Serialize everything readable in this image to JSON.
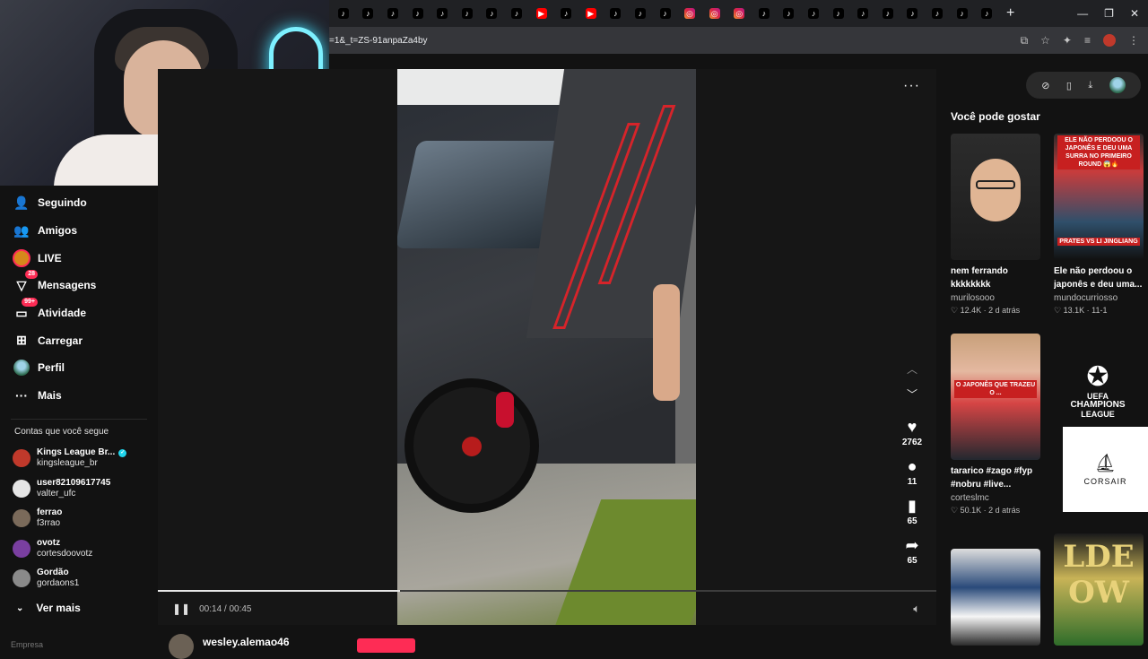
{
  "browser": {
    "tabs": [
      {
        "icon": "tiktok-icon",
        "glyph": "♪"
      },
      {
        "icon": "tiktok-icon",
        "glyph": "♪"
      },
      {
        "icon": "tiktok-icon",
        "glyph": "♪"
      },
      {
        "icon": "tiktok-icon",
        "glyph": "♪"
      },
      {
        "icon": "tiktok-icon",
        "glyph": "♪"
      },
      {
        "icon": "tiktok-icon",
        "glyph": "♪"
      },
      {
        "icon": "tiktok-icon",
        "glyph": "♪"
      },
      {
        "icon": "tiktok-icon",
        "glyph": "♪"
      },
      {
        "icon": "youtube-icon",
        "glyph": "▶"
      },
      {
        "icon": "tiktok-icon",
        "glyph": "♪"
      },
      {
        "icon": "youtube-icon",
        "glyph": "▶"
      },
      {
        "icon": "tiktok-icon",
        "glyph": "♪"
      },
      {
        "icon": "tiktok-icon",
        "glyph": "♪"
      },
      {
        "icon": "tiktok-icon",
        "glyph": "♪"
      },
      {
        "icon": "instagram-icon",
        "glyph": "◎"
      },
      {
        "icon": "instagram-icon",
        "glyph": "◎"
      },
      {
        "icon": "instagram-icon",
        "glyph": "◎"
      },
      {
        "icon": "tiktok-icon",
        "glyph": "♪"
      },
      {
        "icon": "tiktok-icon",
        "glyph": "♪"
      },
      {
        "icon": "tiktok-icon",
        "glyph": "♪"
      },
      {
        "icon": "tiktok-icon",
        "glyph": "♪"
      },
      {
        "icon": "tiktok-icon",
        "glyph": "♪"
      },
      {
        "icon": "tiktok-icon",
        "glyph": "♪"
      },
      {
        "icon": "tiktok-icon",
        "glyph": "♪"
      },
      {
        "icon": "tiktok-icon",
        "glyph": "♪"
      },
      {
        "icon": "tiktok-icon",
        "glyph": "♪"
      },
      {
        "icon": "tiktok-icon",
        "glyph": "♪"
      }
    ],
    "new_tab_glyph": "+",
    "window_controls": {
      "minimize": "—",
      "restore": "❐",
      "close": "✕"
    },
    "url": "=1&_t=ZS-91anpaZa4by"
  },
  "sidebar": {
    "nav": [
      {
        "name": "seguindo",
        "label": "Seguindo",
        "glyph": "👤",
        "badge": ""
      },
      {
        "name": "amigos",
        "label": "Amigos",
        "glyph": "👥",
        "badge": ""
      },
      {
        "name": "live",
        "label": "LIVE",
        "glyph": "",
        "badge": ""
      },
      {
        "name": "mensagens",
        "label": "Mensagens",
        "glyph": "▽",
        "badge": "28"
      },
      {
        "name": "atividade",
        "label": "Atividade",
        "glyph": "▭",
        "badge": "99+"
      },
      {
        "name": "carregar",
        "label": "Carregar",
        "glyph": "⊞",
        "badge": ""
      },
      {
        "name": "perfil",
        "label": "Perfil",
        "glyph": "",
        "badge": ""
      },
      {
        "name": "mais",
        "label": "Mais",
        "glyph": "···",
        "badge": ""
      }
    ],
    "following_title": "Contas que você segue",
    "following": [
      {
        "name": "Kings League Br...",
        "username": "kingsleague_br",
        "verified": true,
        "color": "#c0392b"
      },
      {
        "name": "user82109617745",
        "username": "valter_ufc",
        "verified": false,
        "color": "#e5e5e5"
      },
      {
        "name": "ferrao",
        "username": "f3rrao",
        "verified": false,
        "color": "#7a6a5a"
      },
      {
        "name": "ovotz",
        "username": "cortesdoovotz",
        "verified": false,
        "color": "#7a3fa0"
      },
      {
        "name": "Gordão",
        "username": "gordaons1",
        "verified": false,
        "color": "#8a8a8a"
      }
    ],
    "see_more": "Ver mais",
    "footer": "Empresa"
  },
  "player": {
    "time": "00:14 / 00:45",
    "progress": 0.311,
    "more_glyph": "···",
    "actions": {
      "likes": "2762",
      "comments": "11",
      "saves": "65",
      "shares": "65"
    }
  },
  "video_author": {
    "name": "wesley.alemao46"
  },
  "recommendations": {
    "title": "Você pode gostar",
    "cards": [
      {
        "title": "nem ferrando kkkkkkkk",
        "author": "murilosooo",
        "likes": "12.4K",
        "date": "2 d atrás"
      },
      {
        "title": "Ele não perdoou o japonês e deu uma...",
        "author": "mundocurriosso",
        "likes": "13.1K",
        "date": "11-1",
        "overlay_top": "ELE NÃO PERDOOU O JAPONÊS E DEU UMA SURRA NO PRIMEIRO ROUND 😱🔥",
        "overlay_bottom": "PRATES VS LI JINGLIANG"
      },
      {
        "title": "tararico #zago #fyp #nobru #live...",
        "author": "corteslmc",
        "likes": "50.1K",
        "date": "2 d atrás",
        "overlay_mid": "O JAPONÊS QUE TRAZEU O ..."
      },
      {
        "title": "",
        "author": "",
        "likes": "",
        "date": ""
      },
      {
        "title": "",
        "author": "",
        "likes": "",
        "date": "",
        "bigtext": "LDE\nOW"
      }
    ]
  },
  "overlays": {
    "ucl_line1": "UEFA",
    "ucl_line2": "CHAMPIONS",
    "ucl_line3": "LEAGUE",
    "sponsor": "CORSAIR"
  }
}
